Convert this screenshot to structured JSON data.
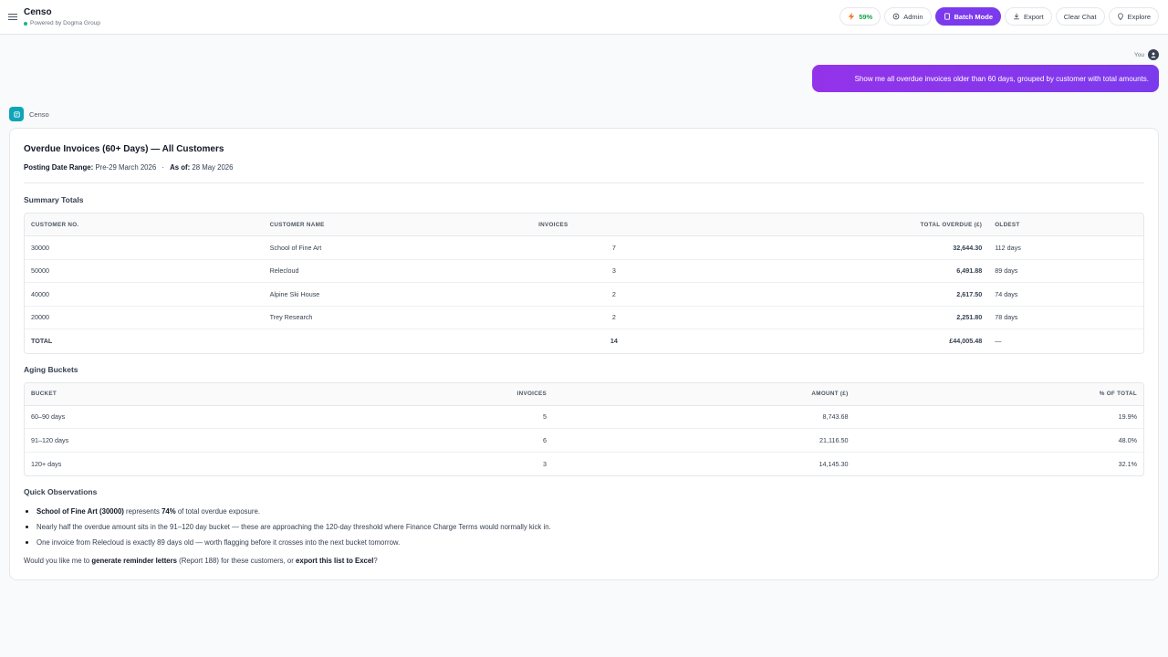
{
  "header": {
    "app_name": "Censo",
    "subtitle": "Powered by Dogma Group",
    "usage_pct": "59%",
    "admin_label": "Admin",
    "batch_label": "Batch Mode",
    "export_label": "Export",
    "clear_label": "Clear Chat",
    "explore_label": "Explore"
  },
  "user_msg": {
    "who": "You",
    "text": "Show me all overdue invoices older than 60 days, grouped by customer with total amounts."
  },
  "bot": {
    "name": "Censo"
  },
  "report": {
    "title": "Overdue Invoices (60+ Days) — All Customers",
    "range_label": "Posting Date Range:",
    "range_value": "Pre-29 March 2026",
    "sep": "·",
    "asof_label": "As of:",
    "asof_value": "28 May 2026"
  },
  "summary": {
    "title": "Summary Totals",
    "headers": [
      "CUSTOMER NO.",
      "CUSTOMER NAME",
      "INVOICES",
      "TOTAL OVERDUE (£)",
      "OLDEST"
    ],
    "rows": [
      [
        "30000",
        "School of Fine Art",
        "7",
        "32,644.30",
        "112 days"
      ],
      [
        "50000",
        "Relecloud",
        "3",
        "6,491.88",
        "89 days"
      ],
      [
        "40000",
        "Alpine Ski House",
        "2",
        "2,617.50",
        "74 days"
      ],
      [
        "20000",
        "Trey Research",
        "2",
        "2,251.80",
        "78 days"
      ]
    ],
    "total": [
      "TOTAL",
      "",
      "14",
      "£44,005.48",
      "—"
    ]
  },
  "aging": {
    "title": "Aging Buckets",
    "headers": [
      "BUCKET",
      "INVOICES",
      "AMOUNT (£)",
      "% OF TOTAL"
    ],
    "rows": [
      [
        "60–90 days",
        "5",
        "8,743.68",
        "19.9%"
      ],
      [
        "91–120 days",
        "6",
        "21,116.50",
        "48.0%"
      ],
      [
        "120+ days",
        "3",
        "14,145.30",
        "32.1%"
      ]
    ]
  },
  "observations": {
    "title": "Quick Observations",
    "o1_bold": "School of Fine Art (30000)",
    "o1_mid": " represents ",
    "o1_pct": "74%",
    "o1_end": " of total overdue exposure.",
    "o2": "Nearly half the overdue amount sits in the 91–120 day bucket — these are approaching the 120-day threshold where Finance Charge Terms would normally kick in.",
    "o3": "One invoice from Relecloud is exactly 89 days old — worth flagging before it crosses into the next bucket tomorrow."
  },
  "closing": {
    "a": "Would you like me to ",
    "b": "generate reminder letters",
    "c": " (Report 188) for these customers, or ",
    "d": "export this list to Excel",
    "e": "?"
  },
  "colors": {
    "accent": "#7c3aed",
    "bot": "#0ea5b7",
    "status": "#10b981"
  },
  "icons": [
    "menu-icon",
    "bolt-icon",
    "gear-icon",
    "document-icon",
    "download-icon",
    "pin-icon",
    "user-icon",
    "bot-icon"
  ]
}
